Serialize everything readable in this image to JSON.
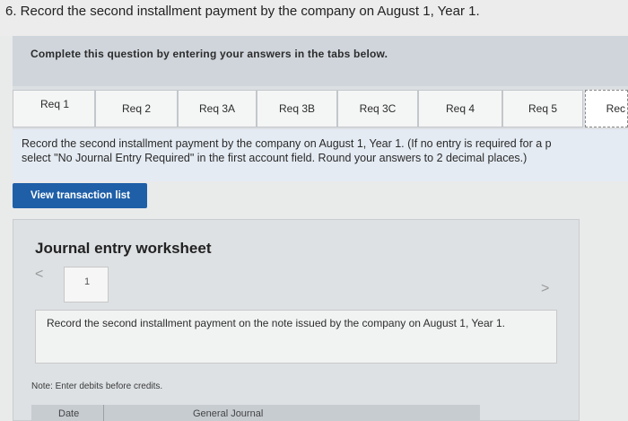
{
  "question": {
    "text": "6. Record the second installment payment by the company on August 1, Year 1."
  },
  "banner": {
    "text": "Complete this question by entering your answers in the tabs below."
  },
  "tabs": [
    {
      "label": "Req 1"
    },
    {
      "label": "Req 2"
    },
    {
      "label": "Req 3A"
    },
    {
      "label": "Req 3B"
    },
    {
      "label": "Req 3C"
    },
    {
      "label": "Req 4"
    },
    {
      "label": "Req 5"
    },
    {
      "label": "Rec"
    }
  ],
  "instructions": {
    "line1": "Record the second installment payment by the company on August 1, Year 1. (If no entry is required for a p",
    "line2": "select \"No Journal Entry Required\" in the first account field. Round your answers to 2 decimal places.)"
  },
  "view_button": {
    "label": "View transaction list"
  },
  "worksheet": {
    "title": "Journal entry worksheet",
    "page_number": "1",
    "entry_text": "Record the second installment payment on the note issued by the company on August 1, Year 1.",
    "note": "Note: Enter debits before credits.",
    "columns": {
      "date": "Date",
      "journal": "General Journal"
    }
  },
  "icons": {
    "prev": "chevron-left-icon",
    "next": "chevron-right-icon"
  },
  "colors": {
    "accent": "#1f5fa8"
  }
}
